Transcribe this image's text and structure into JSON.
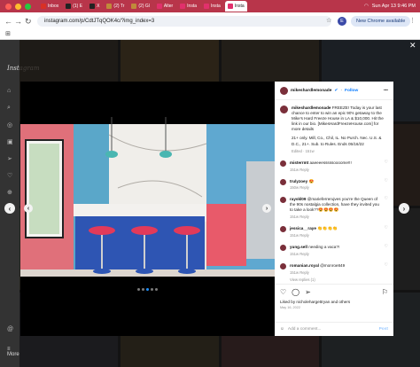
{
  "system": {
    "clock": "Sun Apr 13  9:46 PM"
  },
  "tabs": [
    {
      "label": "Inbox",
      "active": false,
      "color": "#d93025"
    },
    {
      "label": "(1) E",
      "active": false,
      "color": "#222222"
    },
    {
      "label": "X",
      "active": false,
      "color": "#222222"
    },
    {
      "label": "(2) Tr",
      "active": false,
      "color": "#c08a3a"
    },
    {
      "label": "(2) Gl",
      "active": false,
      "color": "#c08a3a"
    },
    {
      "label": "Alter",
      "active": false,
      "color": "#e1306c"
    },
    {
      "label": "Insta",
      "active": false,
      "color": "#e1306c"
    },
    {
      "label": "Insta",
      "active": false,
      "color": "#e1306c"
    },
    {
      "label": "Insta",
      "active": true,
      "color": "#e1306c"
    }
  ],
  "browser": {
    "url": "instagram.com/p/CdtJTqQOK4c/?img_index=3",
    "profile_initial": "E",
    "chrome_button": "New Chrome available"
  },
  "instagram": {
    "logo": "Instagram",
    "more_label": "More"
  },
  "post": {
    "username": "mikeshardlemonade",
    "follow": "Follow",
    "caption_user": "mikeshardlemonade",
    "caption": "FREEZE! Today is your last chance to enter to win an epic 90's getaway to the Mike's Hard Freeze House in LA & $10,000. Hit the link in our bio. [MikesHardFreezeHouse.com] for more details",
    "caption_rules": "21+ only. Mill, Co., Chil, IL. No Purch. Nec. U.S. & D.C., 21+. Sub. to Rules. Ends 05/16/22",
    "caption_meta": "Edited · 151w",
    "comments": [
      {
        "user": "misterrmt",
        "text": "aaeeeesssssoooome!!!",
        "time": "151w",
        "reply": "Reply"
      },
      {
        "user": "trulyzoey",
        "text": "😍",
        "time": "150w",
        "reply": "Reply"
      },
      {
        "user": "rayskl09",
        "text": "@marieferrerujves you're the Queen of the 90s nostalgia collection, have they invited you to take a look??😍😍😍😍",
        "time": "151w",
        "reply": "Reply"
      },
      {
        "user": "jessica__raye",
        "text": "👏👏👏👏",
        "time": "151w",
        "reply": "Reply"
      },
      {
        "user": "yung.sell",
        "text": "needing a vaca?!",
        "time": "151w",
        "reply": "Reply"
      },
      {
        "user": "romanian.royal",
        "text": "@monroe849",
        "time": "151w",
        "reply": "Reply"
      }
    ],
    "view_replies": "View replies (1)",
    "liked_by": "Liked by nicholehargettryan and others",
    "date": "May 16, 2022",
    "add_comment": "Add a comment...",
    "post_label": "Post"
  }
}
